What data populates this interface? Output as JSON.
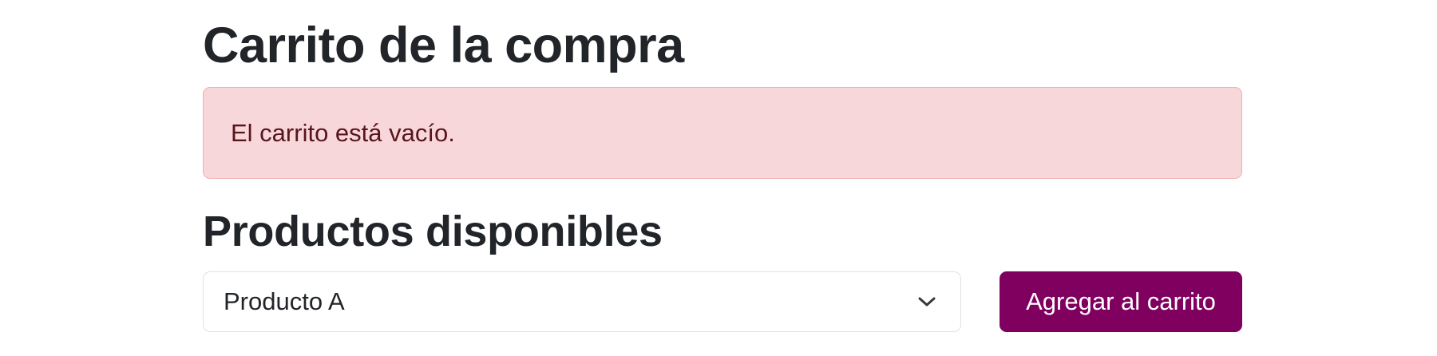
{
  "cart": {
    "title": "Carrito de la compra",
    "empty_message": "El carrito está vacío."
  },
  "products": {
    "title": "Productos disponibles",
    "select": {
      "selected_value": "Producto A"
    },
    "add_button_label": "Agregar al carrito"
  },
  "colors": {
    "alert_background": "#f8d7da",
    "alert_border": "#f1aeb5",
    "alert_text": "#58151c",
    "button_background": "#800060",
    "button_text": "#ffffff",
    "heading_text": "#212529"
  },
  "icons": {
    "select_indicator": "chevron-down-icon"
  }
}
